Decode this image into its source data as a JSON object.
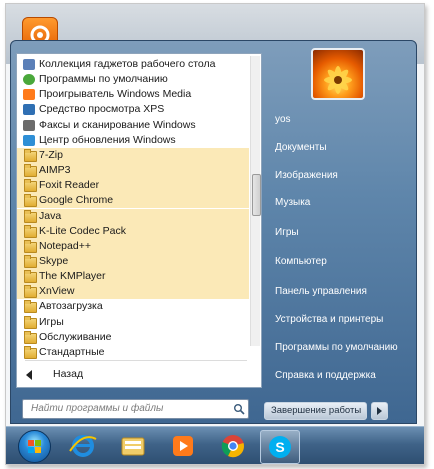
{
  "programs": [
    {
      "label": "Коллекция гаджетов рабочего стола",
      "icon": "gadgets-icon",
      "highlight": false
    },
    {
      "label": "Программы по умолчанию",
      "icon": "default-programs-icon",
      "highlight": false
    },
    {
      "label": "Проигрыватель Windows Media",
      "icon": "windows-media-player-icon",
      "highlight": false
    },
    {
      "label": "Средство просмотра XPS",
      "icon": "xps-viewer-icon",
      "highlight": false
    },
    {
      "label": "Факсы и сканирование Windows",
      "icon": "fax-scan-icon",
      "highlight": false
    },
    {
      "label": "Центр обновления Windows",
      "icon": "windows-update-icon",
      "highlight": false
    },
    {
      "label": "7-Zip",
      "icon": "folder-icon",
      "highlight": true
    },
    {
      "label": "AIMP3",
      "icon": "folder-icon",
      "highlight": true
    },
    {
      "label": "Foxit Reader",
      "icon": "folder-icon",
      "highlight": true
    },
    {
      "label": "Google Chrome",
      "icon": "folder-icon",
      "highlight": true
    },
    {
      "label": "Java",
      "icon": "folder-icon",
      "highlight": true
    },
    {
      "label": "K-Lite Codec Pack",
      "icon": "folder-icon",
      "highlight": true
    },
    {
      "label": "Notepad++",
      "icon": "folder-icon",
      "highlight": true
    },
    {
      "label": "Skype",
      "icon": "folder-icon",
      "highlight": true
    },
    {
      "label": "The KMPlayer",
      "icon": "folder-icon",
      "highlight": true
    },
    {
      "label": "XnView",
      "icon": "folder-icon",
      "highlight": true
    },
    {
      "label": "Автозагрузка",
      "icon": "folder-icon",
      "highlight": false
    },
    {
      "label": "Игры",
      "icon": "folder-icon",
      "highlight": false
    },
    {
      "label": "Обслуживание",
      "icon": "folder-icon",
      "highlight": false
    },
    {
      "label": "Стандартные",
      "icon": "folder-icon",
      "highlight": false
    }
  ],
  "back_label": "Назад",
  "search": {
    "placeholder": "Найти программы и файлы"
  },
  "right_menu": {
    "user": "yos",
    "items": [
      "Документы",
      "Изображения",
      "Музыка",
      "Игры",
      "Компьютер",
      "Панель управления",
      "Устройства и принтеры",
      "Программы по умолчанию",
      "Справка и поддержка"
    ]
  },
  "shutdown_label": "Завершение работы",
  "taskbar": {
    "pinned": [
      "internet-explorer-icon",
      "file-explorer-icon",
      "windows-media-player-icon",
      "chrome-icon",
      "skype-icon"
    ]
  },
  "colors": {
    "highlight": "#fbe9b7",
    "glass": "#5f86ab",
    "taskbar": "#3f6388"
  }
}
